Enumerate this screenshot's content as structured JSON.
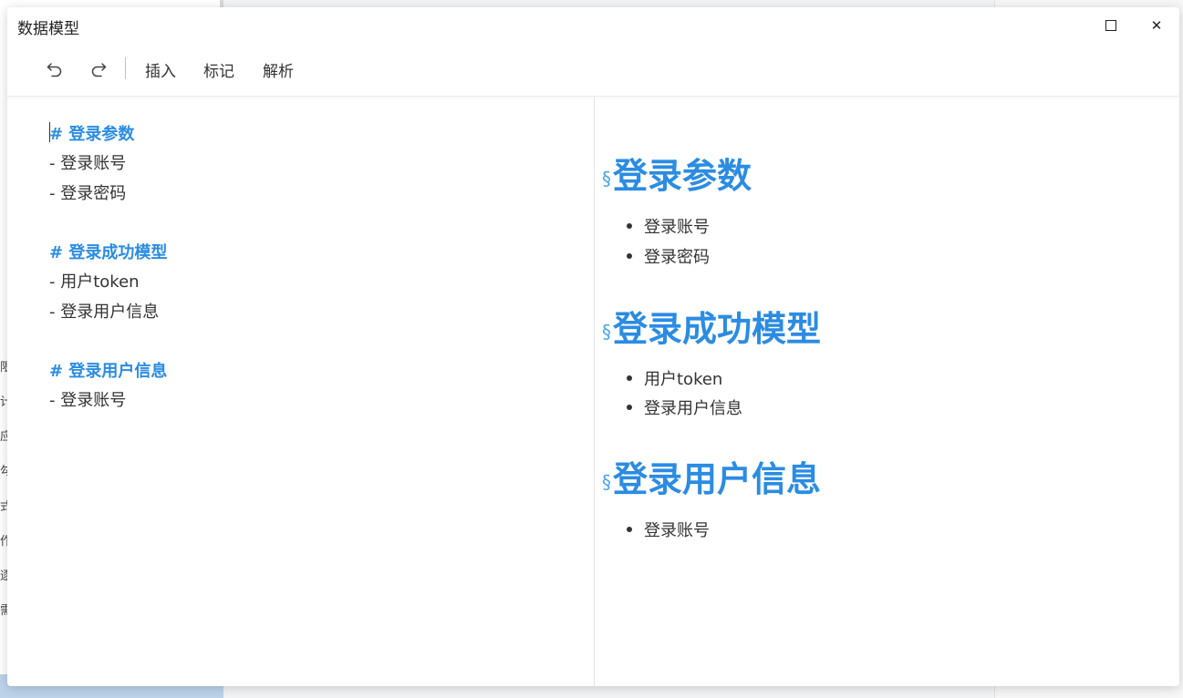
{
  "dialog": {
    "title": "数据模型",
    "maximize_icon": "maximize-icon",
    "close_icon": "close-icon",
    "close_glyph": "✕"
  },
  "toolbar": {
    "undo_icon": "undo-icon",
    "redo_icon": "redo-icon",
    "insert_label": "插入",
    "mark_label": "标记",
    "parse_label": "解析"
  },
  "editor": {
    "lines": [
      "# 登录参数",
      "- 登录账号",
      "- 登录密码",
      "# 登录成功模型",
      "- 用户token",
      "- 登录用户信息",
      "# 登录用户信息",
      "- 登录账号"
    ]
  },
  "preview": {
    "anchor_glyph": "§",
    "sections": [
      {
        "heading": "登录参数",
        "items": [
          "登录账号",
          "登录密码"
        ]
      },
      {
        "heading": "登录成功模型",
        "items": [
          "用户token",
          "登录用户信息"
        ]
      },
      {
        "heading": "登录用户信息",
        "items": [
          "登录账号"
        ]
      }
    ]
  },
  "background": {
    "left_fragments": [
      "限",
      "计",
      "应",
      "勾",
      "式",
      "作",
      "逐",
      "需"
    ]
  },
  "colors": {
    "accent": "#2b8ce2",
    "text": "#333333"
  }
}
